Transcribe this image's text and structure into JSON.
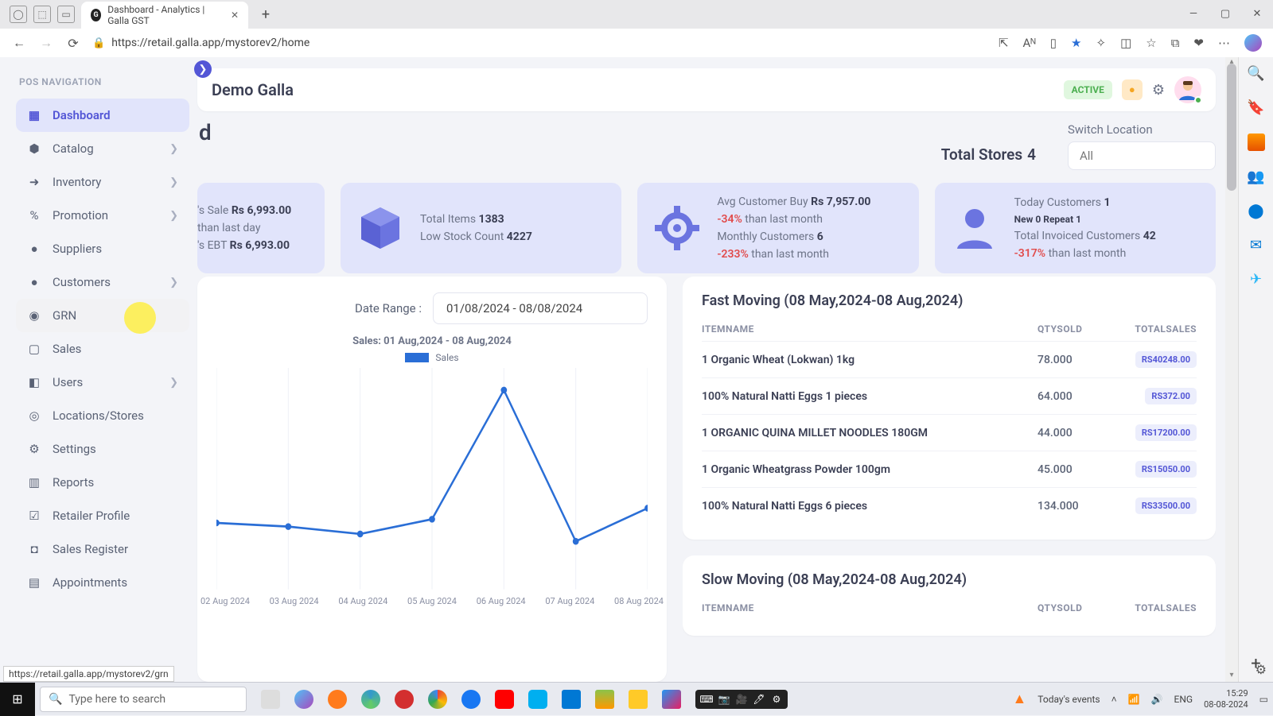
{
  "browser": {
    "tab_title": "Dashboard - Analytics | Galla GST",
    "url": "https://retail.galla.app/mystorev2/home",
    "status_url": "https://retail.galla.app/mystorev2/grn"
  },
  "sidebar": {
    "heading": "POS NAVIGATION",
    "items": [
      {
        "label": "Dashboard",
        "icon": "▦",
        "active": true
      },
      {
        "label": "Catalog",
        "icon": "⬢",
        "chev": true
      },
      {
        "label": "Inventory",
        "icon": "➜",
        "chev": true
      },
      {
        "label": "Promotion",
        "icon": "%",
        "chev": true
      },
      {
        "label": "Suppliers",
        "icon": "●"
      },
      {
        "label": "Customers",
        "icon": "●",
        "chev": true
      },
      {
        "label": "GRN",
        "icon": "◉",
        "hover": true,
        "highlight": true
      },
      {
        "label": "Sales",
        "icon": "▢"
      },
      {
        "label": "Users",
        "icon": "◧",
        "chev": true
      },
      {
        "label": "Locations/Stores",
        "icon": "◎"
      },
      {
        "label": "Settings",
        "icon": "⚙"
      },
      {
        "label": "Reports",
        "icon": "▥"
      },
      {
        "label": "Retailer Profile",
        "icon": "☑"
      },
      {
        "label": "Sales Register",
        "icon": "◘"
      },
      {
        "label": "Appointments",
        "icon": "▤"
      }
    ]
  },
  "header": {
    "title_fragment": "Demo Galla",
    "status": "ACTIVE"
  },
  "page": {
    "total_stores_label": "Total Stores",
    "total_stores": "4",
    "switch_label": "Switch Location",
    "switch_value": "All"
  },
  "cards": {
    "sale": {
      "l1_a": "'s Sale ",
      "l1_b": "Rs 6,993.00",
      "l2": " than last day",
      "l3_a": "'s EBT ",
      "l3_b": "Rs 6,993.00"
    },
    "items": {
      "l1_a": "Total Items ",
      "l1_b": "1383",
      "l2_a": "Low Stock Count ",
      "l2_b": "4227"
    },
    "avg": {
      "l1_a": "Avg Customer Buy ",
      "l1_b": "Rs 7,957.00",
      "l2_a": "-34%",
      "l2_b": " than last month",
      "l3_a": "Monthly Customers ",
      "l3_b": "6",
      "l4_a": "-233%",
      "l4_b": " than last month"
    },
    "cust": {
      "l1_a": "Today Customers ",
      "l1_b": "1",
      "l2": "New  0   Repeat  1",
      "l3_a": "Total Invoiced Customers ",
      "l3_b": "42",
      "l4_a": "-317%",
      "l4_b": " than last month"
    }
  },
  "chart": {
    "date_label": "Date Range :",
    "date_value": "01/08/2024 - 08/08/2024",
    "title": "Sales: 01 Aug,2024 - 08 Aug,2024",
    "legend": "Sales"
  },
  "chart_data": {
    "type": "line",
    "title": "Sales: 01 Aug,2024 - 08 Aug,2024",
    "series": [
      {
        "name": "Sales",
        "values": [
          1800,
          1700,
          1500,
          1900,
          5400,
          1300,
          2200
        ]
      }
    ],
    "categories": [
      "02 Aug 2024",
      "03 Aug 2024",
      "04 Aug 2024",
      "05 Aug 2024",
      "06 Aug 2024",
      "07 Aug 2024",
      "08 Aug 2024"
    ],
    "xlabel": "",
    "ylabel": "",
    "ylim": [
      0,
      6000
    ]
  },
  "fast": {
    "title": "Fast Moving (08 May,2024-08 Aug,2024)",
    "head": {
      "c1": "ITEMNAME",
      "c2": "QTYSOLD",
      "c3": "TOTALSALES"
    },
    "rows": [
      {
        "name": "1 Organic Wheat (Lokwan) 1kg",
        "qty": "78.000",
        "total": "RS40248.00"
      },
      {
        "name": "100% Natural Natti Eggs 1 pieces",
        "qty": "64.000",
        "total": "RS372.00"
      },
      {
        "name": "1 ORGANIC QUINA MILLET NOODLES 180GM",
        "qty": "44.000",
        "total": "RS17200.00"
      },
      {
        "name": "1 Organic Wheatgrass Powder 100gm",
        "qty": "45.000",
        "total": "RS15050.00"
      },
      {
        "name": "100% Natural Natti Eggs 6 pieces",
        "qty": "134.000",
        "total": "RS33500.00"
      }
    ]
  },
  "slow": {
    "title": "Slow Moving (08 May,2024-08 Aug,2024)",
    "head": {
      "c1": "ITEMNAME",
      "c2": "QTYSOLD",
      "c3": "TOTALSALES"
    }
  },
  "taskbar": {
    "search_placeholder": "Type here to search",
    "events": "Today's events",
    "lang": "ENG",
    "time": "15:29",
    "date": "08-08-2024"
  }
}
